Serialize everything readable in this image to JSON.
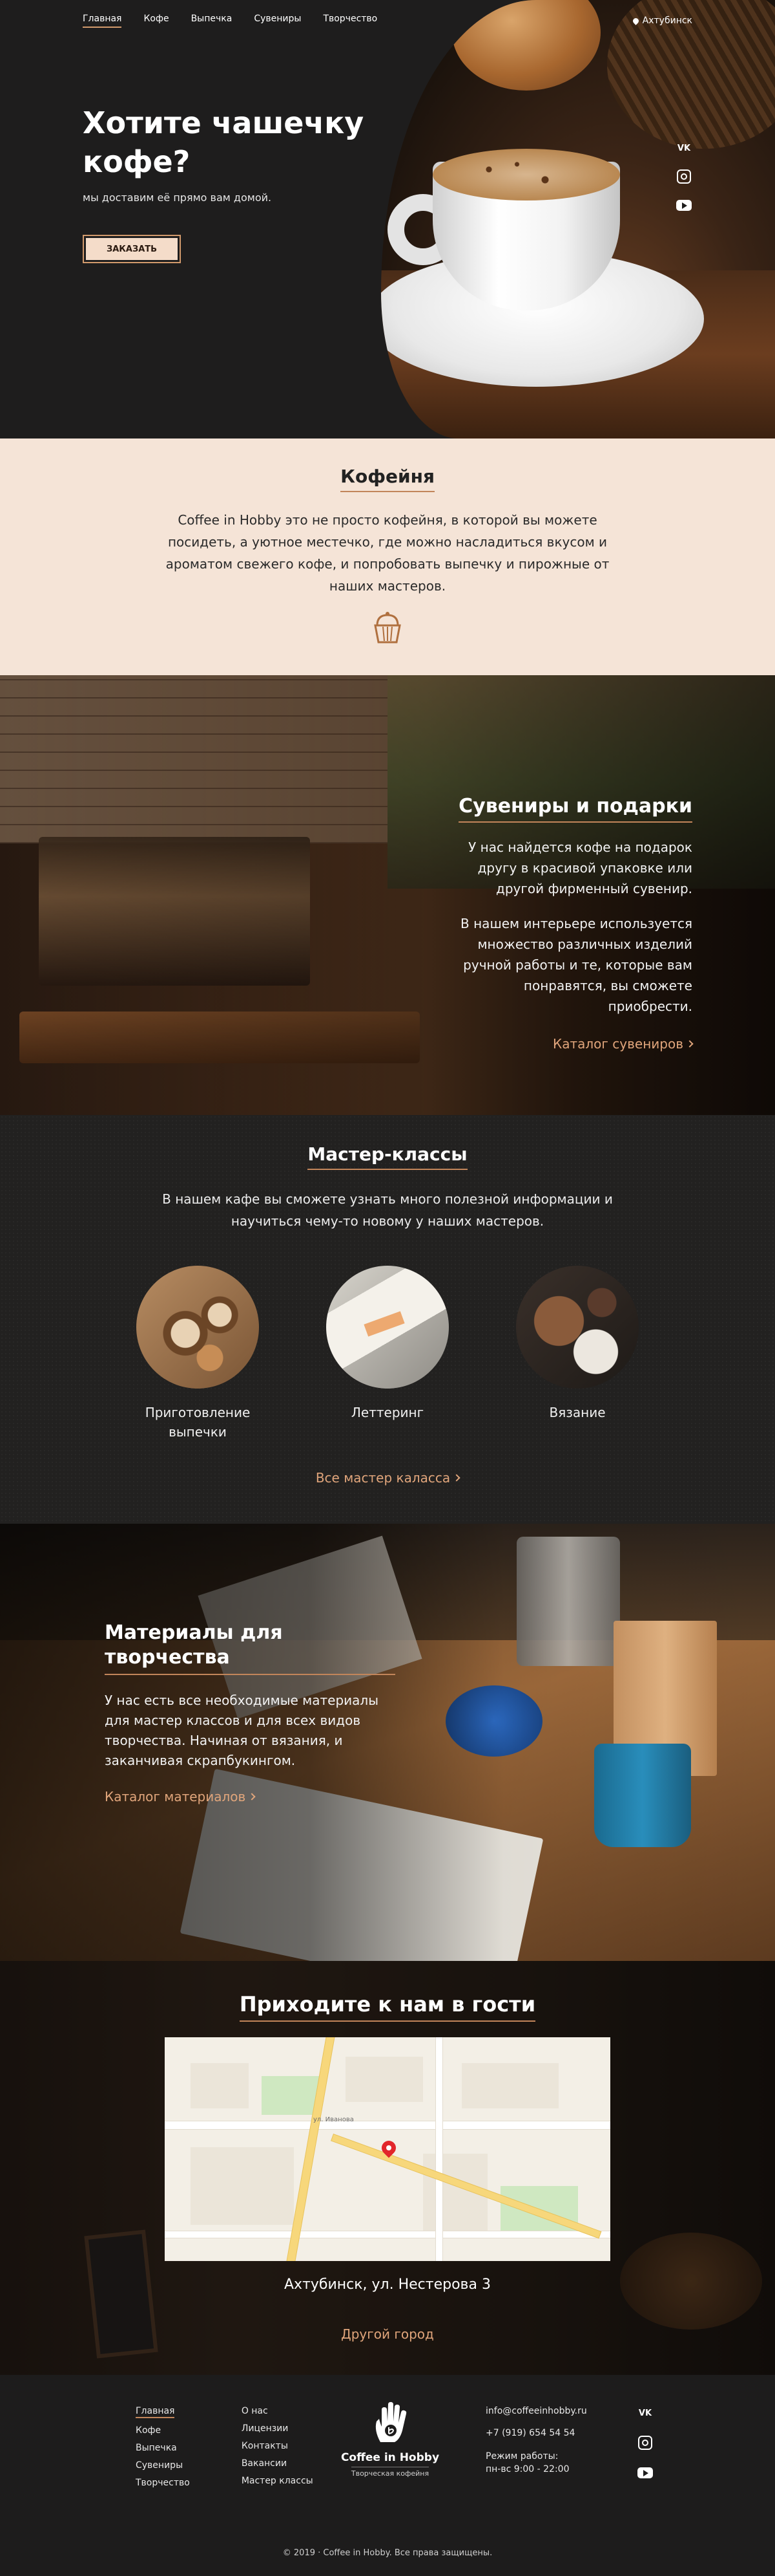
{
  "nav": {
    "items": [
      "Главная",
      "Кофе",
      "Выпечка",
      "Сувениры",
      "Творчество"
    ],
    "city": "Ахтубинск"
  },
  "hero": {
    "title": "Хотите чашечку кофе?",
    "subtitle": "мы доставим её прямо вам домой.",
    "order_button": "ЗАКАЗАТЬ",
    "socials": [
      "vk-icon",
      "instagram-icon",
      "youtube-icon"
    ],
    "vk_text": "VK"
  },
  "about": {
    "title": "Кофейня",
    "text": "Coffee in Hobby это не просто кофейня, в которой вы можете посидеть, а уютное местечко, где можно насладиться вкусом и ароматом свежего кофе, и попробовать выпечку и пирожные от наших мастеров.",
    "icon": "cupcake-icon"
  },
  "souvenirs": {
    "title": "Сувениры и подарки",
    "p1": "У нас найдется кофе на подарок другу в красивой упаковке или другой фирменный сувенир.",
    "p2": "В нашем интерьере используется множество различных изделий ручной работы и те, которые вам понравятся, вы сможете приобрести.",
    "link": "Каталог сувениров"
  },
  "masters": {
    "title": "Мастер-классы",
    "text": "В нашем кафе вы сможете узнать много полезной информации и научиться чему-то новому у наших мастеров.",
    "classes": [
      {
        "label": "Приготовление выпечки"
      },
      {
        "label": "Леттеринг"
      },
      {
        "label": "Вязание"
      }
    ],
    "link": "Все мастер каласса"
  },
  "materials": {
    "title": "Материалы для творчества",
    "text": "У нас есть все необходимые материалы для мастер классов и для всех видов творчества. Начиная от вязания, и заканчивая скрапбукингом.",
    "link": "Каталог материалов"
  },
  "visit": {
    "title": "Приходите к нам в гости",
    "map_street": "ул. Иванова",
    "address": "Ахтубинск, ул. Нестерова 3",
    "link": "Другой город"
  },
  "footer": {
    "col1": [
      "Главная",
      "Кофе",
      "Выпечка",
      "Сувениры",
      "Творчество"
    ],
    "col2": [
      "О нас",
      "Лицензии",
      "Контакты",
      "Вакансии",
      "Мастер классы"
    ],
    "logo_name": "Coffee in Hobby",
    "logo_sub": "Творческая кофейня",
    "email": "info@coffeeinhobby.ru",
    "phone": "+7 (919) 654 54 54",
    "hours_label": "Режим работы:",
    "hours": "пн-вс 9:00 - 22:00",
    "vk_text": "VK",
    "copyright": "© 2019 · Coffee in Hobby. Все права защищены."
  },
  "colors": {
    "accent": "#c2855a",
    "link": "#e0a57b",
    "cream": "#f5e4d7",
    "dark": "#1c1b1b"
  }
}
